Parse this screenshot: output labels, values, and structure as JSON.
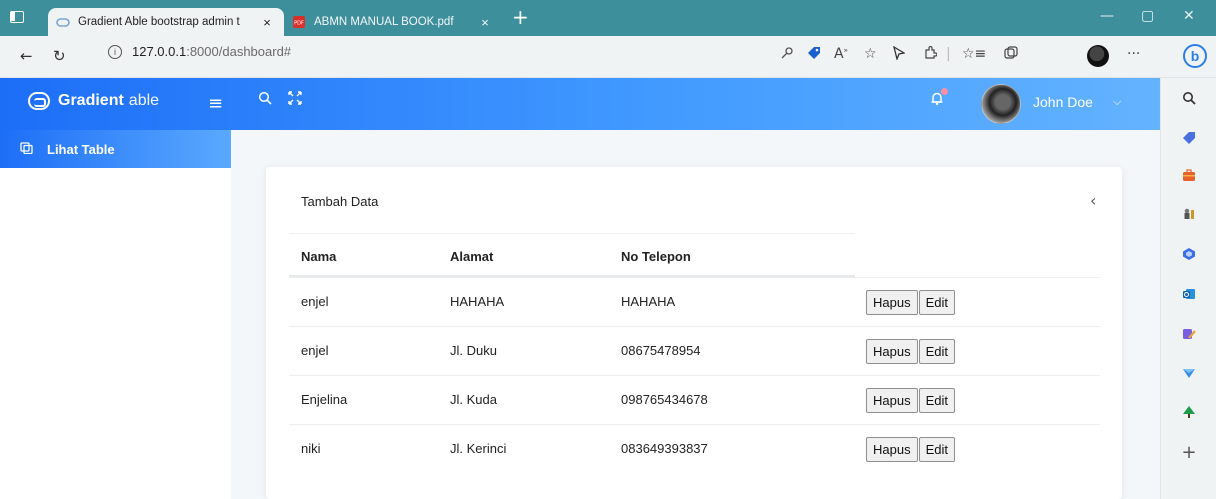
{
  "browser": {
    "tabs": [
      {
        "title": "Gradient Able bootstrap admin t",
        "active": true
      },
      {
        "title": "ABMN MANUAL BOOK.pdf",
        "active": false
      }
    ],
    "tab_close": "×",
    "new_tab": "+",
    "url_host": "127.0.0.1",
    "url_rest": ":8000/dashboard#",
    "more": "···"
  },
  "app": {
    "logo_bold": "Gradient",
    "logo_light": "able",
    "user_name": "John Doe",
    "sidebar": {
      "items": [
        {
          "label": "Lihat Table",
          "active": true
        }
      ]
    }
  },
  "card": {
    "title": "Tambah Data",
    "columns": [
      "Nama",
      "Alamat",
      "No Telepon"
    ],
    "rows": [
      {
        "nama": "enjel",
        "alamat": "HAHAHA",
        "telepon": "HAHAHA"
      },
      {
        "nama": "enjel",
        "alamat": "Jl. Duku",
        "telepon": "08675478954"
      },
      {
        "nama": "Enjelina",
        "alamat": "Jl. Kuda",
        "telepon": "098765434678"
      },
      {
        "nama": "niki",
        "alamat": "Jl. Kerinci",
        "telepon": "083649393837"
      }
    ],
    "delete_label": "Hapus",
    "edit_label": "Edit"
  },
  "colors": {
    "tabstrip": "#3d8f9c",
    "header_start": "#1d6ef7",
    "header_end": "#63b3ff",
    "page_bg": "#f4f7fa"
  }
}
